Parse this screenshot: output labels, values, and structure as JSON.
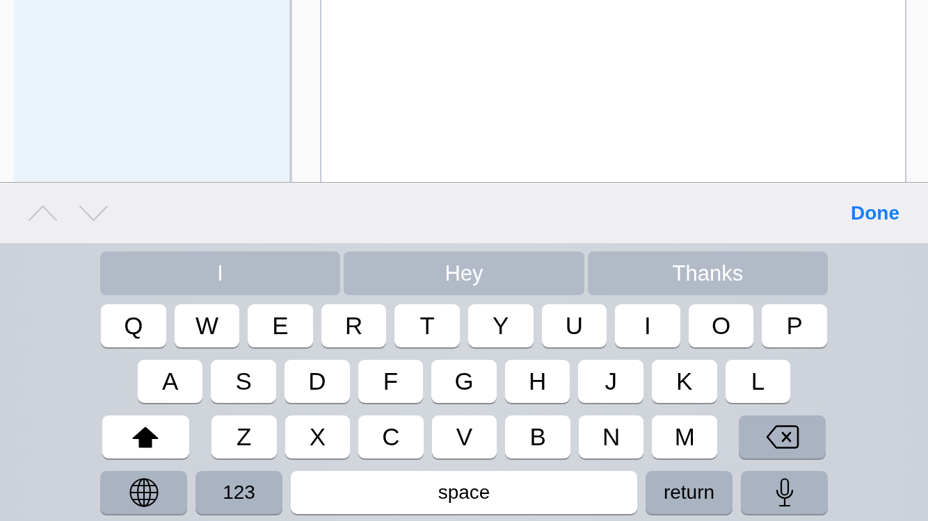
{
  "toolbar": {
    "nav": [
      {
        "kind": "previous",
        "disabled": true
      },
      {
        "kind": "next",
        "disabled": true
      }
    ],
    "done": "Done"
  },
  "keyboard": {
    "predictions": [
      {
        "text": "I"
      },
      {
        "text": "Hey"
      },
      {
        "text": "Thanks"
      }
    ],
    "rows": [
      {
        "keys": [
          {
            "kind": "letter",
            "label": "Q"
          },
          {
            "kind": "letter",
            "label": "W"
          },
          {
            "kind": "letter",
            "label": "E"
          },
          {
            "kind": "letter",
            "label": "R"
          },
          {
            "kind": "letter",
            "label": "T"
          },
          {
            "kind": "letter",
            "label": "Y"
          },
          {
            "kind": "letter",
            "label": "U"
          },
          {
            "kind": "letter",
            "label": "I"
          },
          {
            "kind": "letter",
            "label": "O"
          },
          {
            "kind": "letter",
            "label": "P"
          }
        ]
      },
      {
        "keys": [
          {
            "kind": "letter",
            "label": "A"
          },
          {
            "kind": "letter",
            "label": "S"
          },
          {
            "kind": "letter",
            "label": "D"
          },
          {
            "kind": "letter",
            "label": "F"
          },
          {
            "kind": "letter",
            "label": "G"
          },
          {
            "kind": "letter",
            "label": "H"
          },
          {
            "kind": "letter",
            "label": "J"
          },
          {
            "kind": "letter",
            "label": "K"
          },
          {
            "kind": "letter",
            "label": "L"
          }
        ]
      },
      {
        "keys": [
          {
            "kind": "shift",
            "on": true
          },
          {
            "kind": "letter",
            "label": "Z"
          },
          {
            "kind": "letter",
            "label": "X"
          },
          {
            "kind": "letter",
            "label": "C"
          },
          {
            "kind": "letter",
            "label": "V"
          },
          {
            "kind": "letter",
            "label": "B"
          },
          {
            "kind": "letter",
            "label": "N"
          },
          {
            "kind": "letter",
            "label": "M"
          },
          {
            "kind": "delete"
          }
        ]
      },
      {
        "keys": [
          {
            "kind": "globe"
          },
          {
            "kind": "numbers",
            "label": "123"
          },
          {
            "kind": "space",
            "label": "space"
          },
          {
            "kind": "return",
            "label": "return"
          },
          {
            "kind": "dictation"
          }
        ]
      }
    ]
  }
}
